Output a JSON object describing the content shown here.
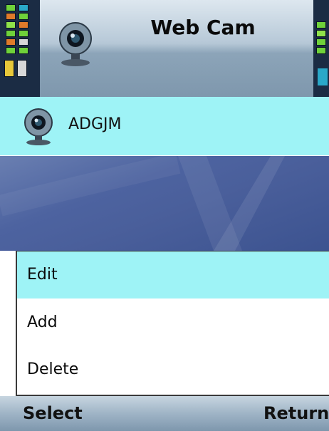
{
  "header": {
    "title": "Web Cam",
    "icon": "webcam-icon"
  },
  "status": {
    "signal_icon": "signal-strength-icon",
    "battery_icon": "battery-icon"
  },
  "list": {
    "items": [
      {
        "label": "ADGJM",
        "icon": "webcam-icon"
      }
    ]
  },
  "menu": {
    "items": [
      {
        "label": "Edit",
        "selected": true
      },
      {
        "label": "Add",
        "selected": false
      },
      {
        "label": "Delete",
        "selected": false
      }
    ]
  },
  "softkeys": {
    "left": "Select",
    "right": "Return"
  },
  "colors": {
    "highlight": "#9ef3f6",
    "header": "#b6c8d7",
    "wallpaper": "#4d63a0"
  }
}
